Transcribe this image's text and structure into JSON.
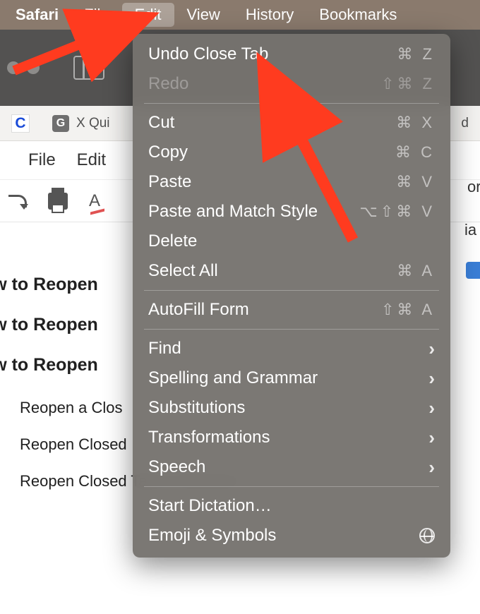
{
  "menubar": {
    "app": "Safari",
    "items": [
      "File",
      "Edit",
      "View",
      "History",
      "Bookmarks"
    ],
    "open_index": 1
  },
  "tabs": {
    "left_favicon_letter": "C",
    "second_favicon_letter": "G",
    "second_title": "X Qui",
    "right_peek": "d"
  },
  "doc_menu": {
    "items": [
      "File",
      "Edit"
    ],
    "right_peek_1": "or",
    "right_peek_2": "ia"
  },
  "content": {
    "headings": [
      "low to Reopen",
      "low to Reopen",
      "low to Reopen"
    ],
    "subs": [
      "Reopen a Clos",
      "Reopen Closed",
      "Reopen Closed Tab in Chrome f…"
    ]
  },
  "dropdown": {
    "groups": [
      [
        {
          "label": "Undo Close Tab",
          "shortcut": "⌘ Z",
          "disabled": false,
          "sub": false
        },
        {
          "label": "Redo",
          "shortcut": "⇧⌘ Z",
          "disabled": true,
          "sub": false
        }
      ],
      [
        {
          "label": "Cut",
          "shortcut": "⌘ X",
          "disabled": false,
          "sub": false
        },
        {
          "label": "Copy",
          "shortcut": "⌘ C",
          "disabled": false,
          "sub": false
        },
        {
          "label": "Paste",
          "shortcut": "⌘ V",
          "disabled": false,
          "sub": false
        },
        {
          "label": "Paste and Match Style",
          "shortcut": "⌥⇧⌘ V",
          "disabled": false,
          "sub": false
        },
        {
          "label": "Delete",
          "shortcut": "",
          "disabled": false,
          "sub": false
        },
        {
          "label": "Select All",
          "shortcut": "⌘ A",
          "disabled": false,
          "sub": false
        }
      ],
      [
        {
          "label": "AutoFill Form",
          "shortcut": "⇧⌘ A",
          "disabled": false,
          "sub": false
        }
      ],
      [
        {
          "label": "Find",
          "shortcut": "",
          "disabled": false,
          "sub": true
        },
        {
          "label": "Spelling and Grammar",
          "shortcut": "",
          "disabled": false,
          "sub": true
        },
        {
          "label": "Substitutions",
          "shortcut": "",
          "disabled": false,
          "sub": true
        },
        {
          "label": "Transformations",
          "shortcut": "",
          "disabled": false,
          "sub": true
        },
        {
          "label": "Speech",
          "shortcut": "",
          "disabled": false,
          "sub": true
        }
      ],
      [
        {
          "label": "Start Dictation…",
          "shortcut": "",
          "disabled": false,
          "sub": false
        },
        {
          "label": "Emoji & Symbols",
          "shortcut": "globe",
          "disabled": false,
          "sub": false
        }
      ]
    ]
  }
}
